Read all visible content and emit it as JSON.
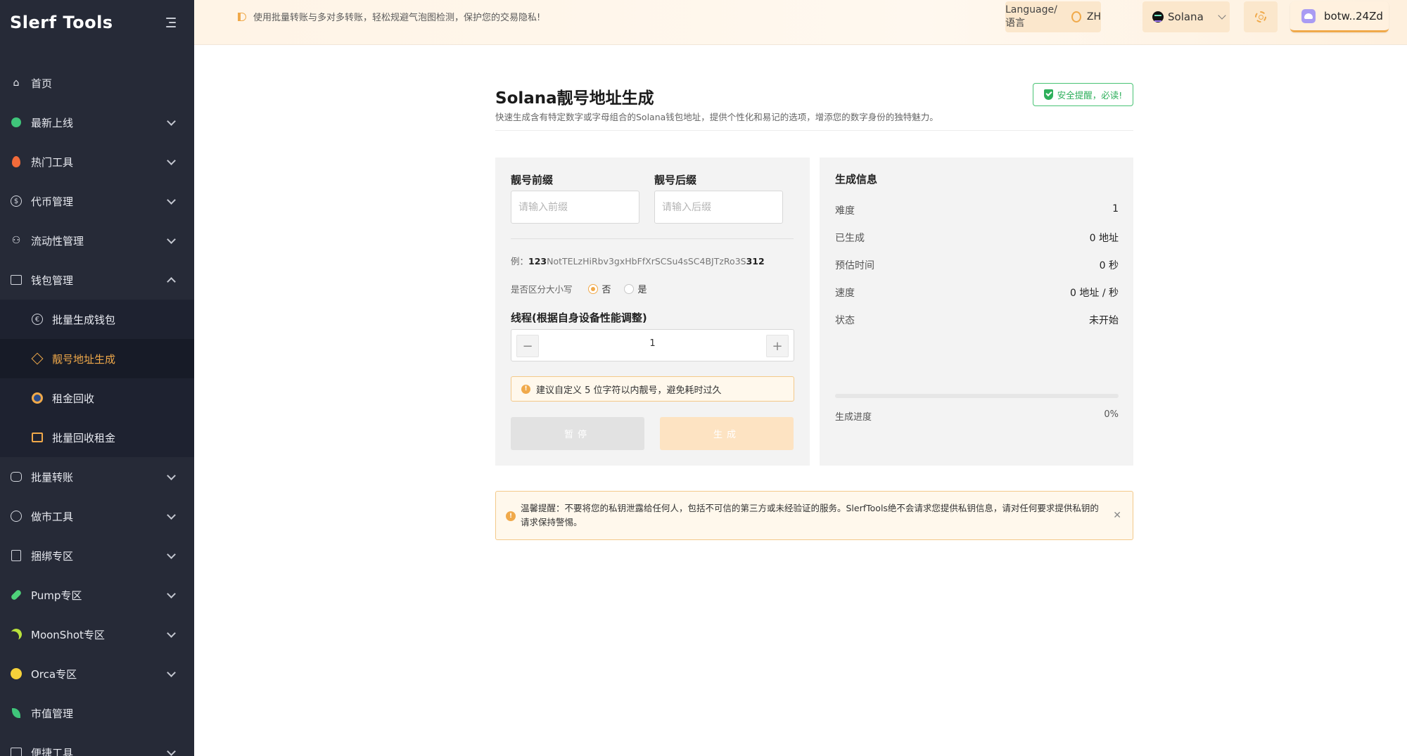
{
  "app": {
    "logo": "Slerf Tools"
  },
  "sidebar": {
    "items": [
      {
        "label": "首页",
        "icon": "home-icon"
      },
      {
        "label": "最新上线",
        "icon": "new-icon"
      },
      {
        "label": "热门工具",
        "icon": "flame-icon"
      },
      {
        "label": "代币管理",
        "icon": "dollar-coin-icon"
      },
      {
        "label": "流动性管理",
        "icon": "liquidity-icon"
      },
      {
        "label": "钱包管理",
        "icon": "wallet-icon"
      },
      {
        "label": "批量转账",
        "icon": "transfer-icon"
      },
      {
        "label": "做市工具",
        "icon": "market-icon"
      },
      {
        "label": "捆绑专区",
        "icon": "bundle-icon"
      },
      {
        "label": "Pump专区",
        "icon": "pill-icon"
      },
      {
        "label": "MoonShot专区",
        "icon": "moon-icon"
      },
      {
        "label": "Orca专区",
        "icon": "orca-icon"
      },
      {
        "label": "市值管理",
        "icon": "leaf-icon"
      },
      {
        "label": "便捷工具",
        "icon": "tools-icon"
      }
    ],
    "wallet_sub": [
      {
        "label": "批量生成钱包",
        "icon": "euro-coin-icon"
      },
      {
        "label": "靓号地址生成",
        "icon": "diamond-icon"
      },
      {
        "label": "租金回收",
        "icon": "rent-icon"
      },
      {
        "label": "批量回收租金",
        "icon": "stack-icon"
      }
    ]
  },
  "topbar": {
    "notice": "使用批量转账与多对多转账，轻松规避气泡图检测，保护您的交易隐私!",
    "language_label": "Language/语言",
    "language_value": "ZH",
    "network": "Solana",
    "wallet": "botw..24Zd"
  },
  "page": {
    "title": "Solana靓号地址生成",
    "subtitle": "快速生成含有特定数字或字母组合的Solana钱包地址，提供个性化和易记的选项，增添您的数字身份的独特魅力。",
    "security_badge": "安全提醒，必读!"
  },
  "form": {
    "prefix_label": "靓号前缀",
    "prefix_placeholder": "请输入前缀",
    "suffix_label": "靓号后缀",
    "suffix_placeholder": "请输入后缀",
    "example_label": "例：",
    "example_prefix": "123",
    "example_middle": "NotTELzHiRbv3gxHbFfXrSCSu4sSC4BJTzRo3S",
    "example_suffix": "312",
    "case_label": "是否区分大小写",
    "case_options": [
      "否",
      "是"
    ],
    "case_selected": "否",
    "thread_label": "线程(根据自身设备性能调整)",
    "thread_value": "1",
    "tip": "建议自定义 5 位字符以内靓号，避免耗时过久",
    "pause_button": "暂停",
    "generate_button": "生成"
  },
  "info": {
    "title": "生成信息",
    "rows": [
      {
        "label": "难度",
        "value": "1"
      },
      {
        "label": "已生成",
        "value": "0 地址"
      },
      {
        "label": "预估时间",
        "value": "0 秒"
      },
      {
        "label": "速度",
        "value": "0 地址 / 秒"
      },
      {
        "label": "状态",
        "value": "未开始"
      }
    ],
    "progress_label": "生成进度",
    "progress_text": "0%",
    "progress_value": 0
  },
  "alert": {
    "text": "温馨提醒：不要将您的私钥泄露给任何人，包括不可信的第三方或未经验证的服务。SlerfTools绝不会请求您提供私钥信息，请对任何要求提供私钥的请求保持警惕。"
  },
  "colors": {
    "accent": "#f0a94a",
    "sidebar": "#262a37",
    "success": "#2eaf5b"
  }
}
